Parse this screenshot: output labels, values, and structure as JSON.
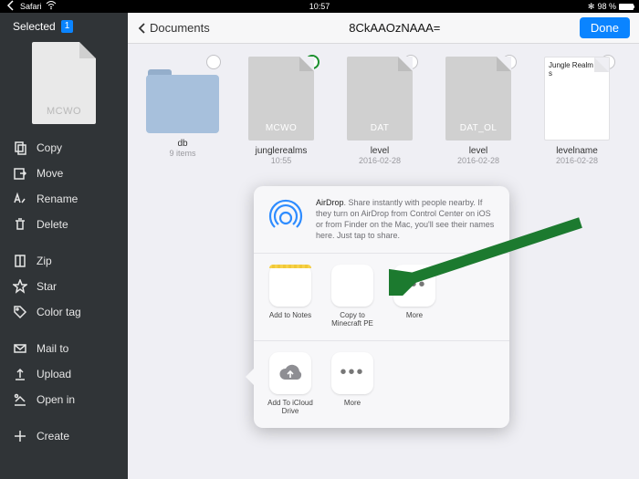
{
  "statusbar": {
    "app": "Safari",
    "time": "10:57",
    "battery": "98 %"
  },
  "sidebar": {
    "selected_label": "Selected",
    "selected_count": "1",
    "thumb_ext": "MCWO",
    "items": {
      "copy": "Copy",
      "move": "Move",
      "rename": "Rename",
      "delete": "Delete",
      "zip": "Zip",
      "star": "Star",
      "colortag": "Color tag",
      "mailto": "Mail to",
      "upload": "Upload",
      "openin": "Open in",
      "create": "Create"
    }
  },
  "toolbar": {
    "back": "Documents",
    "title": "8CkAAOzNAAA=",
    "done": "Done"
  },
  "files": [
    {
      "name": "db",
      "sub": "9 items",
      "ext": ""
    },
    {
      "name": "junglerealms",
      "sub": "10:55",
      "ext": "MCWO"
    },
    {
      "name": "level",
      "sub": "2016-02-28",
      "ext": "DAT"
    },
    {
      "name": "level",
      "sub": "2016-02-28",
      "ext": "DAT_OL"
    },
    {
      "name": "levelname",
      "sub": "2016-02-28",
      "text": "Jungle Realms"
    }
  ],
  "share": {
    "airdrop_title": "AirDrop",
    "airdrop_body": ". Share instantly with people nearby. If they turn on AirDrop from Control Center on iOS or from Finder on the Mac, you'll see their names here. Just tap to share.",
    "apps": {
      "notes": "Add to Notes",
      "minecraft": "Copy to Minecraft PE",
      "more": "More",
      "icloud": "Add To iCloud Drive",
      "more2": "More"
    }
  }
}
